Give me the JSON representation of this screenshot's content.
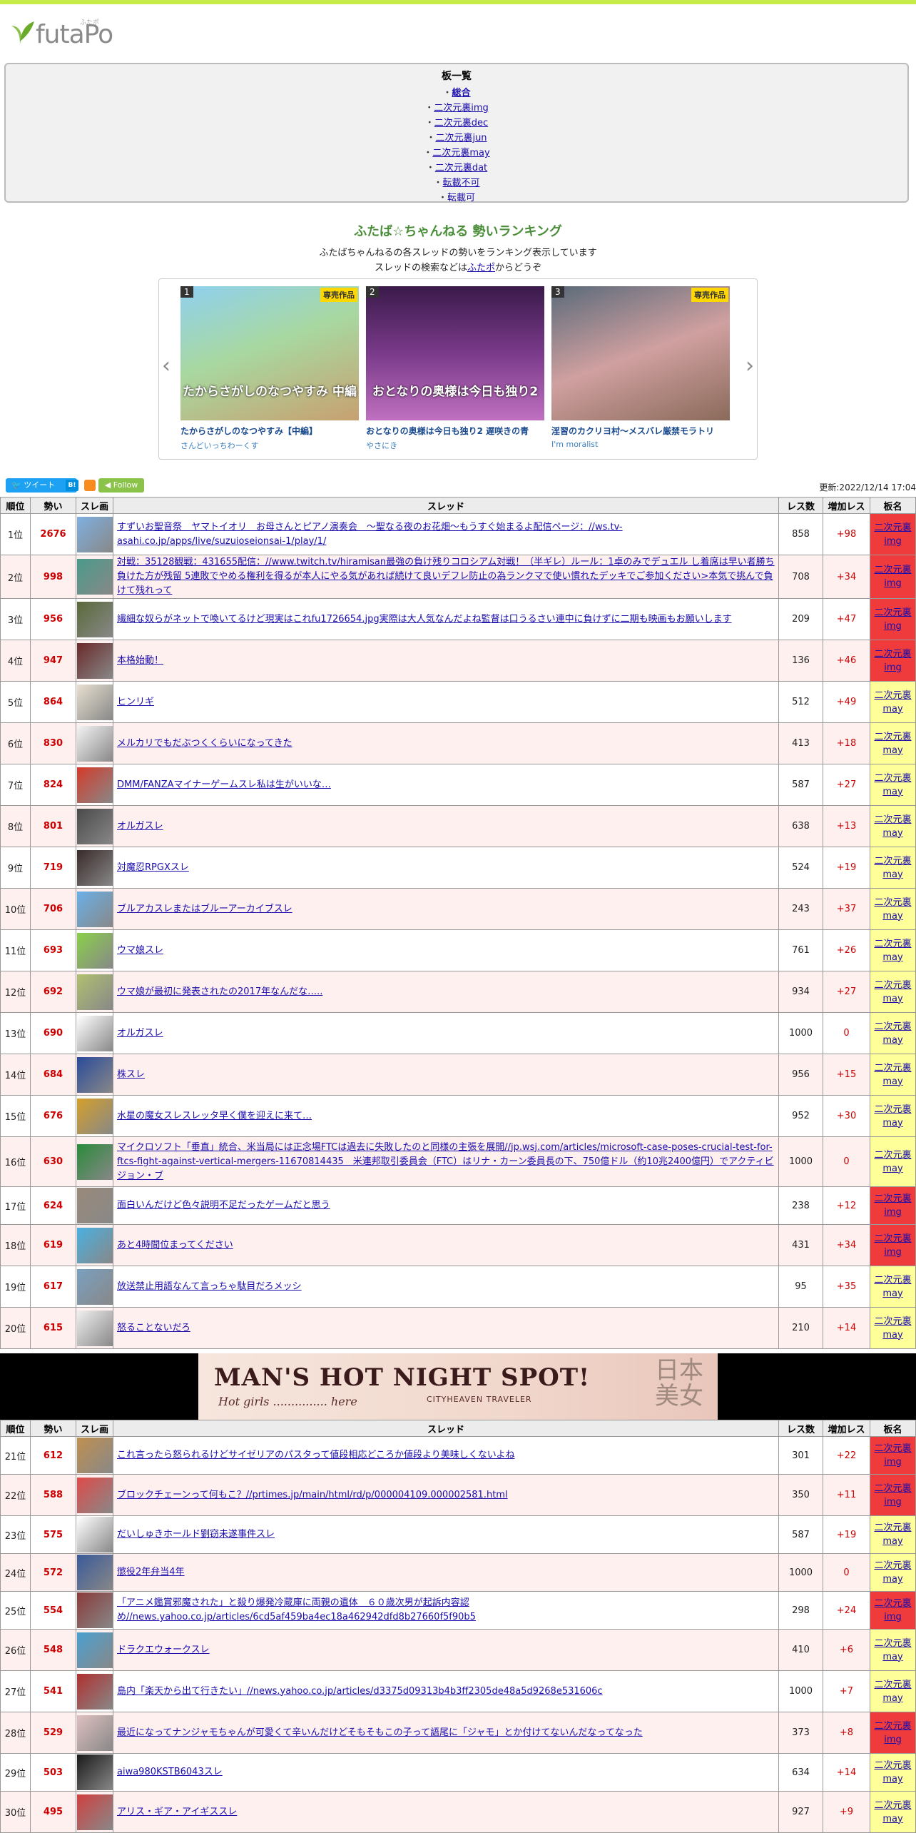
{
  "header": {
    "logo_text": "futaPo",
    "logo_ruby": "ふたポ"
  },
  "boards": {
    "title": "板一覧",
    "items": [
      "総合",
      "二次元裏img",
      "二次元裏dec",
      "二次元裏jun",
      "二次元裏may",
      "二次元裏dat",
      "転載不可",
      "転載可"
    ]
  },
  "ranking": {
    "title": "ふたば☆ちゃんねる 勢いランキング",
    "desc1": "ふたばちゃんねるの各スレッドの勢いをランキング表示しています",
    "desc2_pre": "スレッドの検索などは",
    "desc2_link": "ふたポ",
    "desc2_post": "からどうぞ"
  },
  "carousel": {
    "slides": [
      {
        "num": "1",
        "badge": "専売作品",
        "img_text": "たからさがしのなつやすみ 中編",
        "title": "たからさがしのなつやすみ【中編】",
        "circle": "さんどいっちわーくす"
      },
      {
        "num": "2",
        "badge": "",
        "img_text": "おとなりの奥様は今日も独り2",
        "title": "おとなりの奥様は今日も独り2 遅咲きの青",
        "circle": "やさにき"
      },
      {
        "num": "3",
        "badge": "専売作品",
        "img_text": "",
        "title": "淫習のカクリヨ村～メスバレ厳禁モラトリ",
        "circle": "I'm moralist"
      }
    ]
  },
  "social": {
    "tweet": "ツイート",
    "hatena": "B!",
    "follow": "Follow",
    "updated": "更新:2022/12/14 17:04"
  },
  "table_headers": {
    "pos": "順位",
    "ikioi": "勢い",
    "thumb": "スレ画",
    "thread": "スレッド",
    "res": "レス数",
    "inc": "増加レス",
    "board": "板名"
  },
  "rows_a": [
    {
      "pos": "1位",
      "ikioi": "2676",
      "title": "すずいお聖音祭　ヤマトイオリ　お母さんとピアノ演奏会　～聖なる夜のお花畑～もうすぐ始まるよ配信ページ：//ws.tv-asahi.co.jp/apps/live/suzuioseionsai-1/play/1/",
      "res": "858",
      "inc": "+98",
      "board1": "二次元裏",
      "board2": "img",
      "color": "#7fb0e0"
    },
    {
      "pos": "2位",
      "ikioi": "998",
      "title": "対戦：35128観戦：431655配信：//www.twitch.tv/hiramisan最強の負け残りコロシアム対戦！（半ギレ）ルール：1卓のみでデュエル し着席は早い者勝ち 負けた方が残留 5連敗でやめる権利を得るが本人にやる気があれば続けて良いデフレ防止の為ランクマで使い慣れたデッキでご参加ください>本気で挑んで負けて残れって",
      "res": "708",
      "inc": "+34",
      "board1": "二次元裏",
      "board2": "img",
      "color": "#4a9a8a"
    },
    {
      "pos": "3位",
      "ikioi": "956",
      "title": "繊細な奴らがネットで喚いてるけど現実はこれfu1726654.jpg実際は大人気なんだよね監督は口うるさい連中に負けずに二期も映画もお願いします",
      "res": "209",
      "inc": "+47",
      "board1": "二次元裏",
      "board2": "img",
      "color": "#5a6a3a"
    },
    {
      "pos": "4位",
      "ikioi": "947",
      "title": "本格始動！",
      "res": "136",
      "inc": "+46",
      "board1": "二次元裏",
      "board2": "img",
      "color": "#6a2a2a"
    },
    {
      "pos": "5位",
      "ikioi": "864",
      "title": "ヒンリギ",
      "res": "512",
      "inc": "+49",
      "board1": "二次元裏",
      "board2": "may",
      "color": "#e8e0d0"
    },
    {
      "pos": "6位",
      "ikioi": "830",
      "title": "メルカリでもだぶつくくらいになってきた",
      "res": "413",
      "inc": "+18",
      "board1": "二次元裏",
      "board2": "may",
      "color": "#f4f4f4"
    },
    {
      "pos": "7位",
      "ikioi": "824",
      "title": "DMM/FANZAマイナーゲームスレ私は生がいいな…",
      "res": "587",
      "inc": "+27",
      "board1": "二次元裏",
      "board2": "may",
      "color": "#d43a2a"
    },
    {
      "pos": "8位",
      "ikioi": "801",
      "title": "オルガスレ",
      "res": "638",
      "inc": "+13",
      "board1": "二次元裏",
      "board2": "may",
      "color": "#4a4a4a"
    },
    {
      "pos": "9位",
      "ikioi": "719",
      "title": "対魔忍RPGXスレ",
      "res": "524",
      "inc": "+19",
      "board1": "二次元裏",
      "board2": "may",
      "color": "#3a2a2a"
    },
    {
      "pos": "10位",
      "ikioi": "706",
      "title": "ブルアカスレまたはブルーアーカイブスレ",
      "res": "243",
      "inc": "+37",
      "board1": "二次元裏",
      "board2": "may",
      "color": "#6ab0e8"
    },
    {
      "pos": "11位",
      "ikioi": "693",
      "title": "ウマ娘スレ",
      "res": "761",
      "inc": "+26",
      "board1": "二次元裏",
      "board2": "may",
      "color": "#8ad04a"
    },
    {
      "pos": "12位",
      "ikioi": "692",
      "title": "ウマ娘が最初に発表されたの2017年なんだな…..",
      "res": "934",
      "inc": "+27",
      "board1": "二次元裏",
      "board2": "may",
      "color": "#b0c070"
    },
    {
      "pos": "13位",
      "ikioi": "690",
      "title": "オルガスレ",
      "res": "1000",
      "inc": "0",
      "board1": "二次元裏",
      "board2": "may",
      "color": "#ffffff"
    },
    {
      "pos": "14位",
      "ikioi": "684",
      "title": "株スレ",
      "res": "956",
      "inc": "+15",
      "board1": "二次元裏",
      "board2": "may",
      "color": "#2a4a9a"
    },
    {
      "pos": "15位",
      "ikioi": "676",
      "title": "水星の魔女スレスレッタ早く僕を迎えに来て…",
      "res": "952",
      "inc": "+30",
      "board1": "二次元裏",
      "board2": "may",
      "color": "#d4a02a"
    },
    {
      "pos": "16位",
      "ikioi": "630",
      "title": "マイクロソフト「垂直」統合、米当局には正念場FTCは過去に失敗したのと同様の主張を展開//jp.wsj.com/articles/microsoft-case-poses-crucial-test-for-ftcs-fight-against-vertical-mergers-11670814435　米連邦取引委員会（FTC）はリナ・カーン委員長の下、750億ドル（約10兆2400億円）でアクティビジョン・ブ",
      "res": "1000",
      "inc": "0",
      "board1": "二次元裏",
      "board2": "may",
      "color": "#2a8a3a"
    },
    {
      "pos": "17位",
      "ikioi": "624",
      "title": "面白いんだけど色々説明不足だったゲームだと思う",
      "res": "238",
      "inc": "+12",
      "board1": "二次元裏",
      "board2": "img",
      "color": "#9a8a7a"
    },
    {
      "pos": "18位",
      "ikioi": "619",
      "title": "あと4時間位まってください",
      "res": "431",
      "inc": "+34",
      "board1": "二次元裏",
      "board2": "img",
      "color": "#4ab0e0"
    },
    {
      "pos": "19位",
      "ikioi": "617",
      "title": "放送禁止用語なんて言っちゃ駄目だろメッシ",
      "res": "95",
      "inc": "+35",
      "board1": "二次元裏",
      "board2": "may",
      "color": "#7aa0c0"
    },
    {
      "pos": "20位",
      "ikioi": "615",
      "title": "怒ることないだろ",
      "res": "210",
      "inc": "+14",
      "board1": "二次元裏",
      "board2": "may",
      "color": "#f0f0f0"
    }
  ],
  "banner": {
    "title": "MAN'S HOT NIGHT SPOT!",
    "sub": "Hot girls ............... here",
    "brand": "CITYHEAVEN TRAVELER",
    "jp": "日本美女"
  },
  "rows_b": [
    {
      "pos": "21位",
      "ikioi": "612",
      "title": "これ言ったら怒られるけどサイゼリアのパスタって値段相応どころか値段より美味しくないよね",
      "res": "301",
      "inc": "+22",
      "board1": "二次元裏",
      "board2": "img",
      "color": "#c09050"
    },
    {
      "pos": "22位",
      "ikioi": "588",
      "title": "ブロックチェーンって何もこ？//prtimes.jp/main/html/rd/p/000004109.000002581.html",
      "res": "350",
      "inc": "+11",
      "board1": "二次元裏",
      "board2": "img",
      "color": "#e04a4a"
    },
    {
      "pos": "23位",
      "ikioi": "575",
      "title": "だいしゅきホールド劉窃未遂事件スレ",
      "res": "587",
      "inc": "+19",
      "board1": "二次元裏",
      "board2": "may",
      "color": "#ffffff"
    },
    {
      "pos": "24位",
      "ikioi": "572",
      "title": "懲役2年弁当4年",
      "res": "1000",
      "inc": "0",
      "board1": "二次元裏",
      "board2": "may",
      "color": "#3a5a9a"
    },
    {
      "pos": "25位",
      "ikioi": "554",
      "title": "「アニメ鑑賞邪魔された」と殺り爆発冷蔵庫に両親の遺体　６０歳次男が起訴内容認め//news.yahoo.co.jp/articles/6cd5af459ba4ec18a462942dfd8b27660f5f90b5",
      "res": "298",
      "inc": "+24",
      "board1": "二次元裏",
      "board2": "img",
      "color": "#8a3a3a"
    },
    {
      "pos": "26位",
      "ikioi": "548",
      "title": "ドラクエウォークスレ",
      "res": "410",
      "inc": "+6",
      "board1": "二次元裏",
      "board2": "may",
      "color": "#4aa0d0"
    },
    {
      "pos": "27位",
      "ikioi": "541",
      "title": "島内「楽天から出て行きたい」//news.yahoo.co.jp/articles/d3375d09313b4b3ff2305de48a5d9268e531606c",
      "res": "1000",
      "inc": "+7",
      "board1": "二次元裏",
      "board2": "may",
      "color": "#b03030"
    },
    {
      "pos": "28位",
      "ikioi": "529",
      "title": "最近になってナンジャモちゃんが可愛くて辛いんだけどそもそもこの子って語尾に「ジャモ」とか付けてないんだなってなった",
      "res": "373",
      "inc": "+8",
      "board1": "二次元裏",
      "board2": "img",
      "color": "#e0c0c0"
    },
    {
      "pos": "29位",
      "ikioi": "503",
      "title": "aiwa980KSTB6043スレ",
      "res": "634",
      "inc": "+14",
      "board1": "二次元裏",
      "board2": "may",
      "color": "#1a1a1a"
    },
    {
      "pos": "30位",
      "ikioi": "495",
      "title": "アリス・ギア・アイギススレ",
      "res": "927",
      "inc": "+9",
      "board1": "二次元裏",
      "board2": "may",
      "color": "#d04040"
    }
  ]
}
